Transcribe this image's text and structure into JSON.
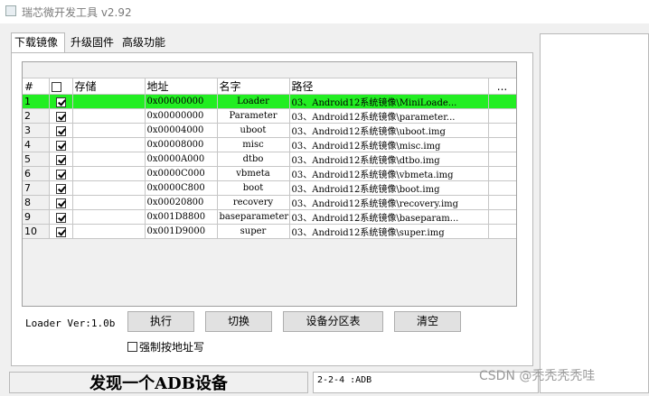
{
  "window": {
    "title": "瑞芯微开发工具 v2.92"
  },
  "tabs": [
    "下载镜像",
    "升级固件",
    "高级功能"
  ],
  "table": {
    "columns": [
      "#",
      "",
      "存储",
      "地址",
      "名字",
      "路径",
      "..."
    ],
    "rows": [
      {
        "num": "1",
        "checked": true,
        "storage": "",
        "address": "0x00000000",
        "name": "Loader",
        "path": "03、Android12系统镜像\\MiniLoade...",
        "selected": true
      },
      {
        "num": "2",
        "checked": true,
        "storage": "",
        "address": "0x00000000",
        "name": "Parameter",
        "path": "03、Android12系统镜像\\parameter...",
        "selected": false
      },
      {
        "num": "3",
        "checked": true,
        "storage": "",
        "address": "0x00004000",
        "name": "uboot",
        "path": "03、Android12系统镜像\\uboot.img",
        "selected": false
      },
      {
        "num": "4",
        "checked": true,
        "storage": "",
        "address": "0x00008000",
        "name": "misc",
        "path": "03、Android12系统镜像\\misc.img",
        "selected": false
      },
      {
        "num": "5",
        "checked": true,
        "storage": "",
        "address": "0x0000A000",
        "name": "dtbo",
        "path": "03、Android12系统镜像\\dtbo.img",
        "selected": false
      },
      {
        "num": "6",
        "checked": true,
        "storage": "",
        "address": "0x0000C000",
        "name": "vbmeta",
        "path": "03、Android12系统镜像\\vbmeta.img",
        "selected": false
      },
      {
        "num": "7",
        "checked": true,
        "storage": "",
        "address": "0x0000C800",
        "name": "boot",
        "path": "03、Android12系统镜像\\boot.img",
        "selected": false
      },
      {
        "num": "8",
        "checked": true,
        "storage": "",
        "address": "0x00020800",
        "name": "recovery",
        "path": "03、Android12系统镜像\\recovery.img",
        "selected": false
      },
      {
        "num": "9",
        "checked": true,
        "storage": "",
        "address": "0x001D8800",
        "name": "baseparameter",
        "path": "03、Android12系统镜像\\baseparam...",
        "selected": false
      },
      {
        "num": "10",
        "checked": true,
        "storage": "",
        "address": "0x001D9000",
        "name": "super",
        "path": "03、Android12系统镜像\\super.img",
        "selected": false
      }
    ]
  },
  "loader_version": "Loader Ver:1.0b",
  "buttons": {
    "run": "执行",
    "switch": "切换",
    "partition": "设备分区表",
    "clear": "清空"
  },
  "force_write": {
    "label": "强制按地址写",
    "checked": false
  },
  "status": {
    "message": "发现一个ADB设备",
    "device": "2-2-4 :ADB"
  },
  "watermark": "CSDN @秃秃秃秃哇",
  "colors": {
    "selected_row": "#22ee22"
  }
}
